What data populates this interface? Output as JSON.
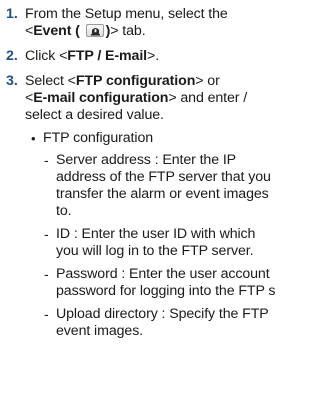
{
  "steps": [
    {
      "number": "1.",
      "text_a": "From the Setup menu, select the",
      "text_b_prefix": "<",
      "text_b_bold": "Event (",
      "text_b_bold2": ")",
      "text_b_suffix": "> tab."
    },
    {
      "number": "2.",
      "text_prefix": "Click <",
      "text_bold": "FTP / E-mail",
      "text_suffix": ">."
    },
    {
      "number": "3.",
      "line1_prefix": "Select <",
      "line1_bold": "FTP configuration",
      "line1_suffix": "> or",
      "line2_prefix": "<",
      "line2_bold": "E-mail configuration",
      "line2_suffix": "> and enter /",
      "line3": "select a desired value."
    }
  ],
  "ftp_section": {
    "bullet": "•",
    "title": "FTP configuration",
    "items": [
      {
        "dash": "-",
        "lines": [
          "Server address : Enter the IP",
          "address of the FTP server that you",
          "transfer the alarm or event images",
          "to."
        ]
      },
      {
        "dash": "-",
        "lines": [
          "ID : Enter the user ID with which",
          "you will log in to the FTP server."
        ]
      },
      {
        "dash": "-",
        "lines": [
          "Password : Enter the user account",
          "password for logging into the FTP s"
        ]
      },
      {
        "dash": "-",
        "lines": [
          "Upload directory : Specify the FTP",
          "event images."
        ]
      }
    ]
  },
  "icons": {
    "event_tab_icon": "siren-icon"
  }
}
